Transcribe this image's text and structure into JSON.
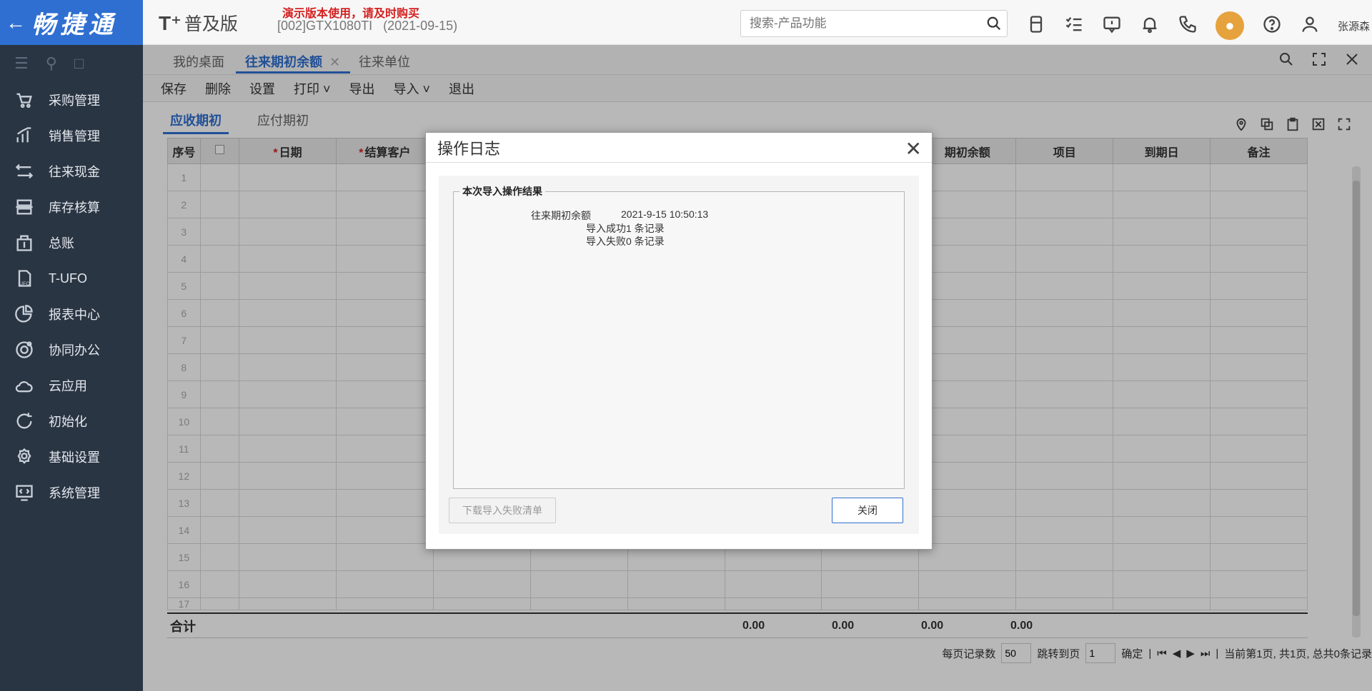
{
  "brand": {
    "name": "畅捷通",
    "back_icon": "back-arrow-icon"
  },
  "sidebar": {
    "items": [
      {
        "label": "采购管理",
        "icon": "purchase-icon"
      },
      {
        "label": "销售管理",
        "icon": "sales-chart-icon"
      },
      {
        "label": "往来现金",
        "icon": "exchange-icon"
      },
      {
        "label": "库存核算",
        "icon": "inventory-icon"
      },
      {
        "label": "总账",
        "icon": "ledger-icon"
      },
      {
        "label": "T-UFO",
        "icon": "ufo-icon"
      },
      {
        "label": "报表中心",
        "icon": "pie-chart-icon"
      },
      {
        "label": "协同办公",
        "icon": "collaboration-icon"
      },
      {
        "label": "云应用",
        "icon": "cloud-icon"
      },
      {
        "label": "初始化",
        "icon": "refresh-icon"
      },
      {
        "label": "基础设置",
        "icon": "settings-icon"
      },
      {
        "label": "系统管理",
        "icon": "system-monitor-icon"
      }
    ]
  },
  "header": {
    "logo": "T⁺",
    "edition": "普及版",
    "demo_warning": "演示版本使用，请及时购买",
    "account": "[002]GTX1080TI",
    "date": "(2021-09-15)",
    "search_placeholder": "搜索-产品功能",
    "user": "张源森"
  },
  "tabs": [
    {
      "label": "我的桌面"
    },
    {
      "label": "往来期初余额"
    },
    {
      "label": "往来单位"
    }
  ],
  "toolbar": [
    "保存",
    "删除",
    "设置",
    "打印",
    "导出",
    "导入",
    "退出"
  ],
  "subtabs": [
    "应收期初",
    "应付期初"
  ],
  "grid": {
    "headers": [
      "序号",
      "",
      "日期",
      "结算客户",
      "",
      "",
      "",
      "",
      "",
      "期初余额",
      "项目",
      "到期日",
      "备注"
    ],
    "row_numbers": [
      "1",
      "2",
      "3",
      "4",
      "5",
      "6",
      "7",
      "8",
      "9",
      "10",
      "11",
      "12",
      "13",
      "14",
      "15",
      "16",
      "17"
    ],
    "sum_label": "合计",
    "sum_values": [
      "0.00",
      "0.00",
      "0.00",
      "0.00"
    ]
  },
  "pager": {
    "per_page_label": "每页记录数",
    "per_page": "50",
    "jump_label": "跳转到页",
    "jump_page": "1",
    "confirm": "确定",
    "status": "当前第1页, 共1页, 总共0条记录"
  },
  "modal": {
    "title": "操作日志",
    "legend": "本次导入操作结果",
    "log_name": "往来期初余额",
    "log_time": "2021-9-15 10:50:13",
    "success": "导入成功1 条记录",
    "failed": "导入失败0 条记录",
    "download_button": "下载导入失败清单",
    "close_button": "关闭"
  }
}
